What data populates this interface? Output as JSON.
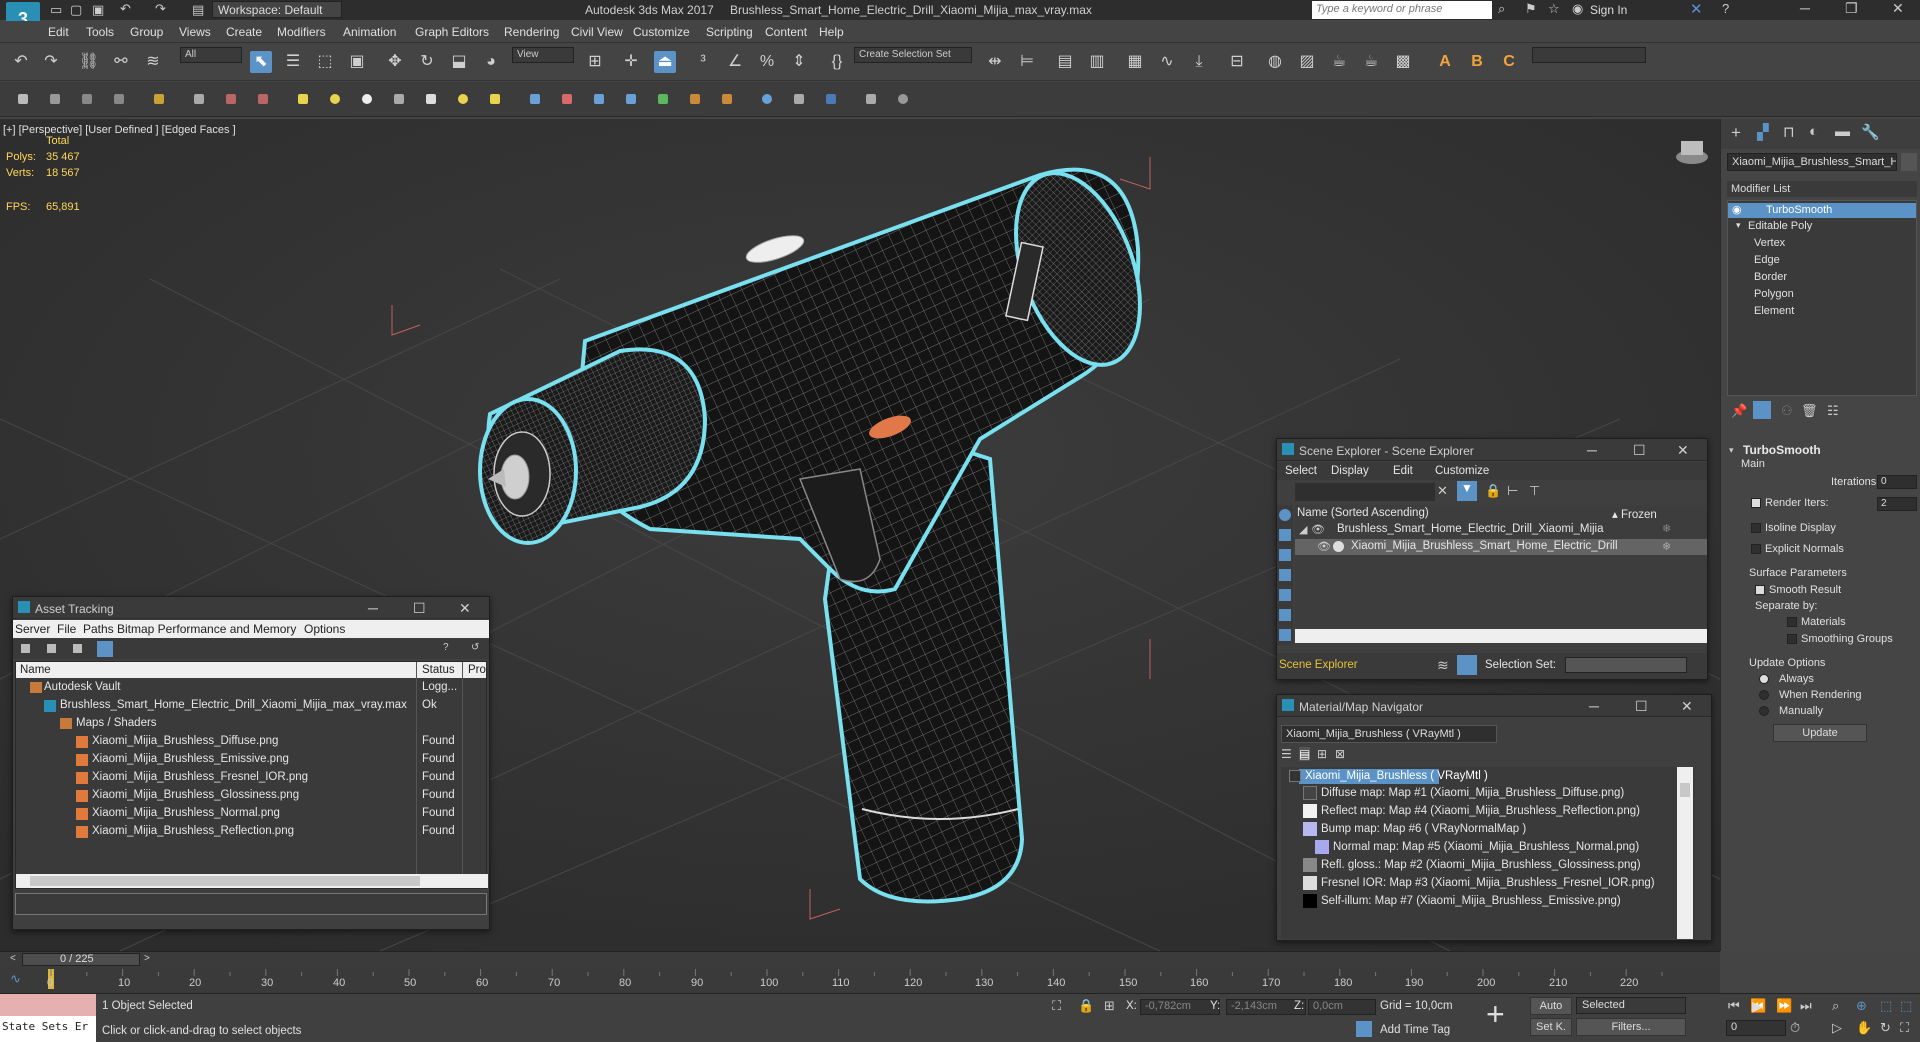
{
  "titlebar": {
    "app_title": "Autodesk 3ds Max 2017",
    "doc_title": "Brushless_Smart_Home_Electric_Drill_Xiaomi_Mijia_max_vray.max",
    "workspace": "Workspace: Default",
    "search_placeholder": "Type a keyword or phrase",
    "sign_in": "Sign In",
    "logo": "3"
  },
  "menu": [
    "Edit",
    "Tools",
    "Group",
    "Views",
    "Create",
    "Modifiers",
    "Animation",
    "Graph Editors",
    "Rendering",
    "Civil View",
    "Customize",
    "Scripting",
    "Content",
    "Help"
  ],
  "toolbar": {
    "filter": "All",
    "view_dropdown": "View",
    "selection_set": "Create Selection Set",
    "render_letters": [
      "A",
      "B",
      "C"
    ]
  },
  "viewport": {
    "label": "[+] [Perspective]  [User Defined ]  [Edged Faces ]",
    "stats_total": "Total",
    "polys_label": "Polys:",
    "polys_value": "35 467",
    "verts_label": "Verts:",
    "verts_value": "18 567",
    "fps_label": "FPS:",
    "fps_value": "65,891"
  },
  "command_panel": {
    "object_name": "Xiaomi_Mijia_Brushless_Smart_Hon",
    "modifier_list": "Modifier List",
    "stack": [
      "TurboSmooth",
      "Editable Poly",
      "Vertex",
      "Edge",
      "Border",
      "Polygon",
      "Element"
    ],
    "rollout_title": "TurboSmooth",
    "main_label": "Main",
    "iterations_label": "Iterations:",
    "iterations_value": "0",
    "render_iters_label": "Render Iters:",
    "render_iters_value": "2",
    "isoline": "Isoline Display",
    "explicit_normals": "Explicit Normals",
    "surface_params": "Surface Parameters",
    "smooth_result": "Smooth Result",
    "separate_by": "Separate by:",
    "materials": "Materials",
    "smoothing_groups": "Smoothing Groups",
    "update_options": "Update Options",
    "always": "Always",
    "when_rendering": "When Rendering",
    "manually": "Manually",
    "update_button": "Update"
  },
  "scene_explorer": {
    "title": "Scene Explorer - Scene Explorer",
    "menu": [
      "Select",
      "Display",
      "Edit",
      "Customize"
    ],
    "col_name": "Name (Sorted Ascending)",
    "col_frozen": "▴ Frozen",
    "rows": [
      "Brushless_Smart_Home_Electric_Drill_Xiaomi_Mijia",
      "Xiaomi_Mijia_Brushless_Smart_Home_Electric_Drill"
    ],
    "footer_name": "Scene Explorer",
    "selection_set_label": "Selection Set:"
  },
  "material_navigator": {
    "title": "Material/Map Navigator",
    "field": "Xiaomi_Mijia_Brushless  ( VRayMtl )",
    "rows": [
      "Xiaomi_Mijia_Brushless  ( VRayMtl )",
      "Diffuse map: Map #1 (Xiaomi_Mijia_Brushless_Diffuse.png)",
      "Reflect map: Map #4 (Xiaomi_Mijia_Brushless_Reflection.png)",
      "Bump map: Map #6  ( VRayNormalMap )",
      "Normal map: Map #5 (Xiaomi_Mijia_Brushless_Normal.png)",
      "Refl. gloss.: Map #2 (Xiaomi_Mijia_Brushless_Glossiness.png)",
      "Fresnel IOR: Map #3 (Xiaomi_Mijia_Brushless_Fresnel_IOR.png)",
      "Self-illum: Map #7 (Xiaomi_Mijia_Brushless_Emissive.png)"
    ]
  },
  "asset_tracking": {
    "title": "Asset Tracking",
    "menu": [
      "Server",
      "File",
      "Paths",
      "Bitmap Performance and Memory",
      "Options"
    ],
    "col_name": "Name",
    "col_status": "Status",
    "col_pro": "Pro",
    "rows": [
      {
        "name": "Autodesk Vault",
        "status": "Logg..."
      },
      {
        "name": "Brushless_Smart_Home_Electric_Drill_Xiaomi_Mijia_max_vray.max",
        "status": "Ok"
      },
      {
        "name": "Maps / Shaders",
        "status": ""
      },
      {
        "name": "Xiaomi_Mijia_Brushless_Diffuse.png",
        "status": "Found"
      },
      {
        "name": "Xiaomi_Mijia_Brushless_Emissive.png",
        "status": "Found"
      },
      {
        "name": "Xiaomi_Mijia_Brushless_Fresnel_IOR.png",
        "status": "Found"
      },
      {
        "name": "Xiaomi_Mijia_Brushless_Glossiness.png",
        "status": "Found"
      },
      {
        "name": "Xiaomi_Mijia_Brushless_Normal.png",
        "status": "Found"
      },
      {
        "name": "Xiaomi_Mijia_Brushless_Reflection.png",
        "status": "Found"
      }
    ]
  },
  "timeline": {
    "frame": "0 / 225",
    "ticks": [
      "0",
      "10",
      "20",
      "30",
      "40",
      "50",
      "60",
      "70",
      "80",
      "90",
      "100",
      "110",
      "120",
      "130",
      "140",
      "150",
      "160",
      "170",
      "180",
      "190",
      "200",
      "210",
      "220"
    ]
  },
  "status": {
    "selected": "1 Object Selected",
    "prompt": "Click or click-and-drag to select objects",
    "state_sets": "State Sets Er",
    "x_label": "X:",
    "x_value": "-0,782cm",
    "y_label": "Y:",
    "y_value": "-2,143cm",
    "z_label": "Z:",
    "z_value": "0,0cm",
    "grid": "Grid = 10,0cm",
    "add_time_tag": "Add Time Tag",
    "auto": "Auto",
    "selected_dropdown": "Selected",
    "set_k": "Set K.",
    "filters": "Filters...",
    "frame_field": "0"
  }
}
